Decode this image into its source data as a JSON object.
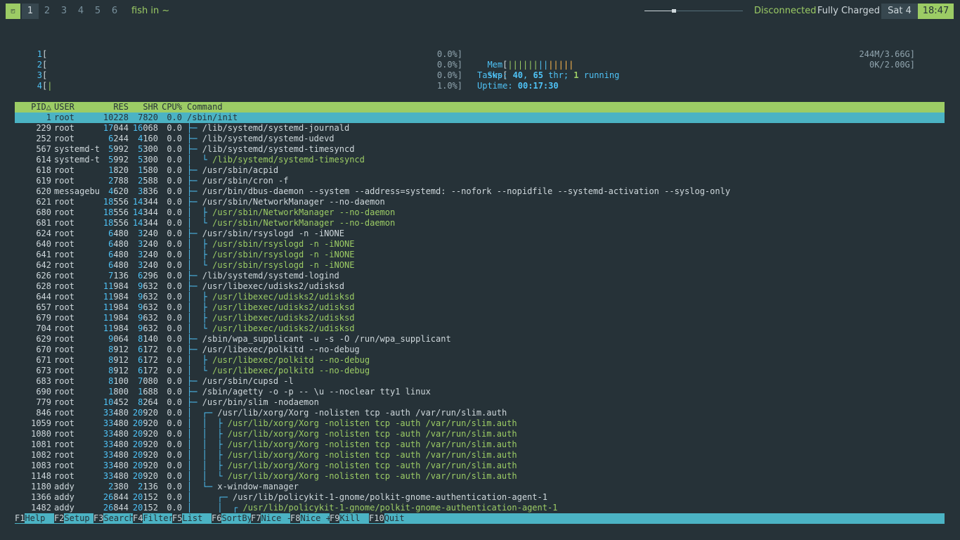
{
  "topbar": {
    "grid_icon": "grid-icon",
    "workspaces": [
      "1",
      "2",
      "3",
      "4",
      "5",
      "6"
    ],
    "active_workspace": "1",
    "window_title": "fish in ~",
    "volume_level": 0.28,
    "network": "Disconnected",
    "battery": "Fully Charged",
    "day": "Sat 4",
    "time": "18:47"
  },
  "meters": {
    "cpus": [
      {
        "num": "1",
        "pct": "0.0%]"
      },
      {
        "num": "2",
        "pct": "0.0%]"
      },
      {
        "num": "3",
        "pct": "0.0%]"
      },
      {
        "num": "4",
        "pct": "1.0%]"
      }
    ],
    "mem_label": "Mem",
    "mem_value": "244M/3.66G]",
    "swp_label": "Swp",
    "swp_value": "0K/2.00G]",
    "tasks_label": "Tasks: ",
    "tasks": "40",
    "thr": "65",
    "thr_label": " thr; ",
    "running": "1",
    "running_label": " running",
    "uptime_label": "Uptime: ",
    "uptime": "00:17:30"
  },
  "table": {
    "headers": {
      "pid": "PID△",
      "user": "USER",
      "res": "RES",
      "shr": "SHR",
      "cpu": "CPU%",
      "cmd": "Command"
    },
    "rows": [
      {
        "pid": "1",
        "user": "root",
        "res": "10228",
        "shr": "7820",
        "cpu": "0.0",
        "tree": "",
        "cmd": "/sbin/init",
        "thread": false
      },
      {
        "pid": "229",
        "user": "root",
        "res": "17044",
        "shr": "16068",
        "cpu": "0.0",
        "tree": "├─ ",
        "cmd": "/lib/systemd/systemd-journald",
        "thread": false
      },
      {
        "pid": "252",
        "user": "root",
        "res": "6244",
        "shr": "4160",
        "cpu": "0.0",
        "tree": "├─ ",
        "cmd": "/lib/systemd/systemd-udevd",
        "thread": false
      },
      {
        "pid": "567",
        "user": "systemd-t",
        "res": "5992",
        "shr": "5300",
        "cpu": "0.0",
        "tree": "├─ ",
        "cmd": "/lib/systemd/systemd-timesyncd",
        "thread": false
      },
      {
        "pid": "614",
        "user": "systemd-t",
        "res": "5992",
        "shr": "5300",
        "cpu": "0.0",
        "tree": "│  └ ",
        "cmd": "/lib/systemd/systemd-timesyncd",
        "thread": true
      },
      {
        "pid": "618",
        "user": "root",
        "res": "1820",
        "shr": "1580",
        "cpu": "0.0",
        "tree": "├─ ",
        "cmd": "/usr/sbin/acpid",
        "thread": false
      },
      {
        "pid": "619",
        "user": "root",
        "res": "2788",
        "shr": "2588",
        "cpu": "0.0",
        "tree": "├─ ",
        "cmd": "/usr/sbin/cron -f",
        "thread": false
      },
      {
        "pid": "620",
        "user": "messagebu",
        "res": "4620",
        "shr": "3836",
        "cpu": "0.0",
        "tree": "├─ ",
        "cmd": "/usr/bin/dbus-daemon --system --address=systemd: --nofork --nopidfile --systemd-activation --syslog-only",
        "thread": false
      },
      {
        "pid": "621",
        "user": "root",
        "res": "18556",
        "shr": "14344",
        "cpu": "0.0",
        "tree": "├─ ",
        "cmd": "/usr/sbin/NetworkManager --no-daemon",
        "thread": false
      },
      {
        "pid": "680",
        "user": "root",
        "res": "18556",
        "shr": "14344",
        "cpu": "0.0",
        "tree": "│  ├ ",
        "cmd": "/usr/sbin/NetworkManager --no-daemon",
        "thread": true
      },
      {
        "pid": "681",
        "user": "root",
        "res": "18556",
        "shr": "14344",
        "cpu": "0.0",
        "tree": "│  └ ",
        "cmd": "/usr/sbin/NetworkManager --no-daemon",
        "thread": true
      },
      {
        "pid": "624",
        "user": "root",
        "res": "6480",
        "shr": "3240",
        "cpu": "0.0",
        "tree": "├─ ",
        "cmd": "/usr/sbin/rsyslogd -n -iNONE",
        "thread": false
      },
      {
        "pid": "640",
        "user": "root",
        "res": "6480",
        "shr": "3240",
        "cpu": "0.0",
        "tree": "│  ├ ",
        "cmd": "/usr/sbin/rsyslogd -n -iNONE",
        "thread": true
      },
      {
        "pid": "641",
        "user": "root",
        "res": "6480",
        "shr": "3240",
        "cpu": "0.0",
        "tree": "│  ├ ",
        "cmd": "/usr/sbin/rsyslogd -n -iNONE",
        "thread": true
      },
      {
        "pid": "642",
        "user": "root",
        "res": "6480",
        "shr": "3240",
        "cpu": "0.0",
        "tree": "│  └ ",
        "cmd": "/usr/sbin/rsyslogd -n -iNONE",
        "thread": true
      },
      {
        "pid": "626",
        "user": "root",
        "res": "7136",
        "shr": "6296",
        "cpu": "0.0",
        "tree": "├─ ",
        "cmd": "/lib/systemd/systemd-logind",
        "thread": false
      },
      {
        "pid": "628",
        "user": "root",
        "res": "11984",
        "shr": "9632",
        "cpu": "0.0",
        "tree": "├─ ",
        "cmd": "/usr/libexec/udisks2/udisksd",
        "thread": false
      },
      {
        "pid": "644",
        "user": "root",
        "res": "11984",
        "shr": "9632",
        "cpu": "0.0",
        "tree": "│  ├ ",
        "cmd": "/usr/libexec/udisks2/udisksd",
        "thread": true
      },
      {
        "pid": "657",
        "user": "root",
        "res": "11984",
        "shr": "9632",
        "cpu": "0.0",
        "tree": "│  ├ ",
        "cmd": "/usr/libexec/udisks2/udisksd",
        "thread": true
      },
      {
        "pid": "679",
        "user": "root",
        "res": "11984",
        "shr": "9632",
        "cpu": "0.0",
        "tree": "│  ├ ",
        "cmd": "/usr/libexec/udisks2/udisksd",
        "thread": true
      },
      {
        "pid": "704",
        "user": "root",
        "res": "11984",
        "shr": "9632",
        "cpu": "0.0",
        "tree": "│  └ ",
        "cmd": "/usr/libexec/udisks2/udisksd",
        "thread": true
      },
      {
        "pid": "629",
        "user": "root",
        "res": "9064",
        "shr": "8140",
        "cpu": "0.0",
        "tree": "├─ ",
        "cmd": "/sbin/wpa_supplicant -u -s -O /run/wpa_supplicant",
        "thread": false
      },
      {
        "pid": "670",
        "user": "root",
        "res": "8912",
        "shr": "6172",
        "cpu": "0.0",
        "tree": "├─ ",
        "cmd": "/usr/libexec/polkitd --no-debug",
        "thread": false
      },
      {
        "pid": "671",
        "user": "root",
        "res": "8912",
        "shr": "6172",
        "cpu": "0.0",
        "tree": "│  ├ ",
        "cmd": "/usr/libexec/polkitd --no-debug",
        "thread": true
      },
      {
        "pid": "673",
        "user": "root",
        "res": "8912",
        "shr": "6172",
        "cpu": "0.0",
        "tree": "│  └ ",
        "cmd": "/usr/libexec/polkitd --no-debug",
        "thread": true
      },
      {
        "pid": "683",
        "user": "root",
        "res": "8100",
        "shr": "7080",
        "cpu": "0.0",
        "tree": "├─ ",
        "cmd": "/usr/sbin/cupsd -l",
        "thread": false
      },
      {
        "pid": "690",
        "user": "root",
        "res": "1800",
        "shr": "1688",
        "cpu": "0.0",
        "tree": "├─ ",
        "cmd": "/sbin/agetty -o -p -- \\u --noclear tty1 linux",
        "thread": false
      },
      {
        "pid": "779",
        "user": "root",
        "res": "10452",
        "shr": "8264",
        "cpu": "0.0",
        "tree": "├─ ",
        "cmd": "/usr/bin/slim -nodaemon",
        "thread": false
      },
      {
        "pid": "846",
        "user": "root",
        "res": "33480",
        "shr": "20920",
        "cpu": "0.0",
        "tree": "│  ┌─ ",
        "cmd": "/usr/lib/xorg/Xorg -nolisten tcp -auth /var/run/slim.auth",
        "thread": false
      },
      {
        "pid": "1059",
        "user": "root",
        "res": "33480",
        "shr": "20920",
        "cpu": "0.0",
        "tree": "│  │  ├ ",
        "cmd": "/usr/lib/xorg/Xorg -nolisten tcp -auth /var/run/slim.auth",
        "thread": true
      },
      {
        "pid": "1080",
        "user": "root",
        "res": "33480",
        "shr": "20920",
        "cpu": "0.0",
        "tree": "│  │  ├ ",
        "cmd": "/usr/lib/xorg/Xorg -nolisten tcp -auth /var/run/slim.auth",
        "thread": true
      },
      {
        "pid": "1081",
        "user": "root",
        "res": "33480",
        "shr": "20920",
        "cpu": "0.0",
        "tree": "│  │  ├ ",
        "cmd": "/usr/lib/xorg/Xorg -nolisten tcp -auth /var/run/slim.auth",
        "thread": true
      },
      {
        "pid": "1082",
        "user": "root",
        "res": "33480",
        "shr": "20920",
        "cpu": "0.0",
        "tree": "│  │  ├ ",
        "cmd": "/usr/lib/xorg/Xorg -nolisten tcp -auth /var/run/slim.auth",
        "thread": true
      },
      {
        "pid": "1083",
        "user": "root",
        "res": "33480",
        "shr": "20920",
        "cpu": "0.0",
        "tree": "│  │  ├ ",
        "cmd": "/usr/lib/xorg/Xorg -nolisten tcp -auth /var/run/slim.auth",
        "thread": true
      },
      {
        "pid": "1148",
        "user": "root",
        "res": "33480",
        "shr": "20920",
        "cpu": "0.0",
        "tree": "│  │  └ ",
        "cmd": "/usr/lib/xorg/Xorg -nolisten tcp -auth /var/run/slim.auth",
        "thread": true
      },
      {
        "pid": "1180",
        "user": "addy",
        "res": "2380",
        "shr": "2136",
        "cpu": "0.0",
        "tree": "│  └─ ",
        "cmd": "x-window-manager",
        "thread": false
      },
      {
        "pid": "1366",
        "user": "addy",
        "res": "26844",
        "shr": "20152",
        "cpu": "0.0",
        "tree": "│     ┌─ ",
        "cmd": "/usr/lib/policykit-1-gnome/polkit-gnome-authentication-agent-1",
        "thread": false
      },
      {
        "pid": "1482",
        "user": "addy",
        "res": "26844",
        "shr": "20152",
        "cpu": "0.0",
        "tree": "│     │  ┌ ",
        "cmd": "/usr/lib/policykit-1-gnome/polkit-gnome-authentication-agent-1",
        "thread": true
      }
    ]
  },
  "footer": [
    {
      "key": "F1",
      "label": "Help  "
    },
    {
      "key": "F2",
      "label": "Setup "
    },
    {
      "key": "F3",
      "label": "Search"
    },
    {
      "key": "F4",
      "label": "Filter"
    },
    {
      "key": "F5",
      "label": "List  "
    },
    {
      "key": "F6",
      "label": "SortBy"
    },
    {
      "key": "F7",
      "label": "Nice -"
    },
    {
      "key": "F8",
      "label": "Nice +"
    },
    {
      "key": "F9",
      "label": "Kill  "
    },
    {
      "key": "F10",
      "label": "Quit"
    }
  ],
  "colors": {
    "accent": "#9ccc65",
    "highlight": "#4bb3c4",
    "cyan": "#4fc3f7",
    "bg": "#263238"
  }
}
